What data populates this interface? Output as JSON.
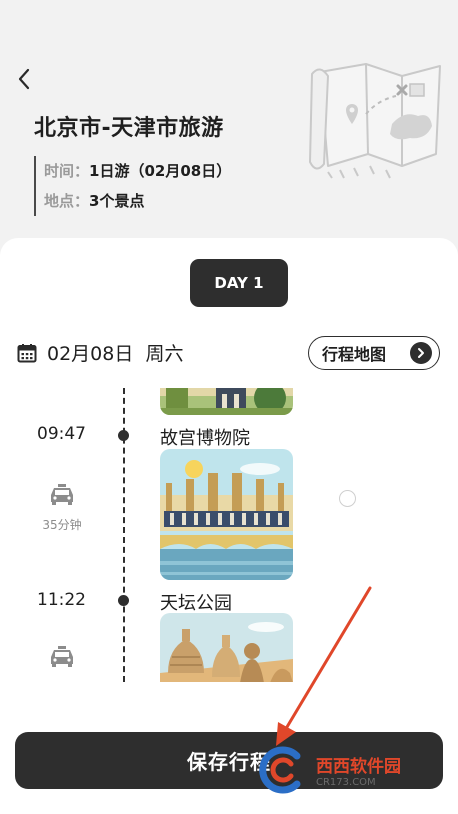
{
  "header": {
    "title": "北京市-天津市旅游",
    "time_label": "时间",
    "time_value": "1日游（02月08日）",
    "location_label": "地点",
    "location_value": "3个景点"
  },
  "day_tab": {
    "label": "DAY 1"
  },
  "date_bar": {
    "date": "02月08日",
    "weekday": "周六",
    "map_button_label": "行程地图"
  },
  "itinerary": [
    {
      "time": "09:47",
      "name": "故宫博物院"
    },
    {
      "time": "11:22",
      "name": "天坛公园"
    }
  ],
  "transport": [
    {
      "mode_icon": "taxi-icon",
      "duration": "35分钟"
    },
    {
      "mode_icon": "taxi-icon",
      "duration": ""
    }
  ],
  "save_button": {
    "label": "保存行程"
  },
  "watermark": {
    "name": "西西软件园",
    "url": "CR173.COM"
  },
  "colors": {
    "dark": "#2e2e2e",
    "background": "#f2f2f2",
    "accent_red": "#e0472a"
  }
}
